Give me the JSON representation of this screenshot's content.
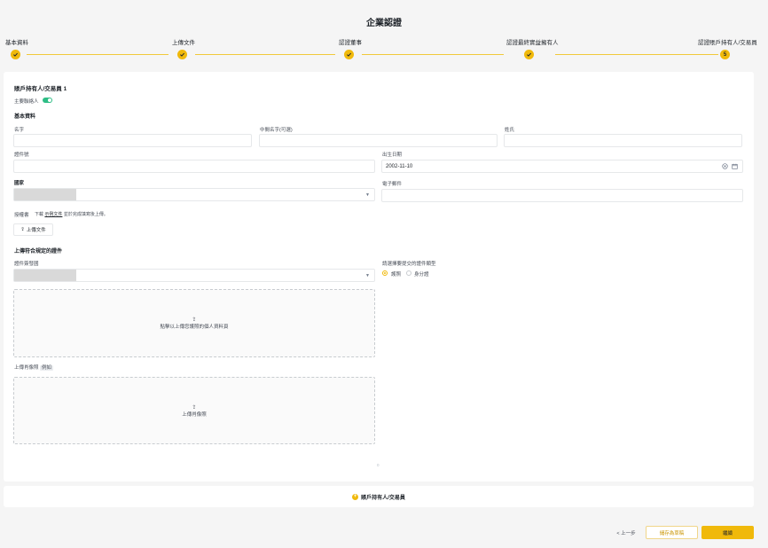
{
  "page": {
    "title": "企業認證"
  },
  "stepper": {
    "steps": [
      {
        "label": "基本資料",
        "state": "done"
      },
      {
        "label": "上傳文件",
        "state": "done"
      },
      {
        "label": "認證董事",
        "state": "done"
      },
      {
        "label": "認證最終實益擁有人",
        "state": "done"
      },
      {
        "label": "認證賬戶持有人/交易員",
        "state": "current",
        "number": "5"
      }
    ]
  },
  "form": {
    "holder_title": "賬戶持有人/交易員 1",
    "primary_contact_label": "主要聯絡人",
    "basic_info_title": "基本資料",
    "first_name_label": "名字",
    "middle_name_label": "中間名字(可選)",
    "last_name_label": "姓氏",
    "id_number_label": "證件號",
    "dob_label": "出生日期",
    "dob_value": "2002-11-10",
    "country_label": "國家",
    "email_label": "電子郵件",
    "authorization_label": "授權書",
    "authorization_hint_prefix": "下載",
    "authorization_link": "示例文件",
    "authorization_hint_suffix": "並於完成填寫後上傳。",
    "upload_file_button": "上傳文件",
    "upload_docs_title": "上傳符合規定的證件",
    "issuing_country_label": "證件簽發國",
    "doc_type_label": "請選擇要提交的證件類型",
    "doc_types": [
      {
        "label": "護照",
        "selected": true
      },
      {
        "label": "身分證",
        "selected": false
      }
    ],
    "passport_dropzone_text": "點擊以上傳您護照的個人資料頁",
    "photo_label": "上傳肖像照",
    "photo_example": "例如",
    "photo_dropzone_text": "上傳肖像照",
    "page_indicator": "0"
  },
  "add_holder": {
    "label": "賬戶持有人/交易員"
  },
  "footer": {
    "back_label": "< 上一步",
    "save_draft_label": "儲存為草稿",
    "continue_label": "繼續"
  },
  "colors": {
    "accent": "#f0b90b",
    "toggle_on": "#2ebd85"
  }
}
